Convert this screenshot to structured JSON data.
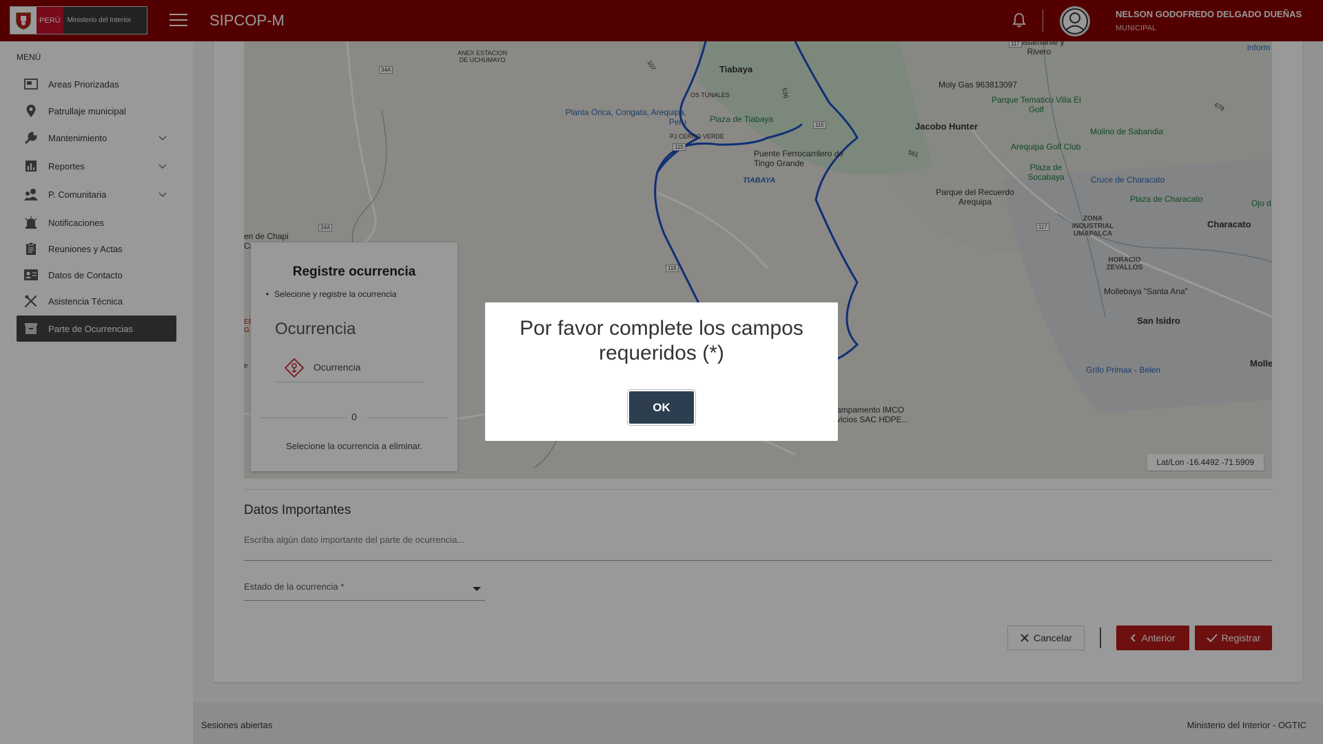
{
  "header": {
    "logo_country": "PERÚ",
    "logo_ministry": "Ministerio del Interior",
    "app_title": "SIPCOP-M",
    "user_name": "NELSON GODOFREDO DELGADO DUEÑAS",
    "user_role": "MUNICIPAL",
    "brand_color": "#8b0000"
  },
  "sidebar": {
    "menu_title": "MENÚ",
    "items": [
      {
        "label": "Areas Priorizadas",
        "icon": "map-area-icon",
        "expandable": false
      },
      {
        "label": "Patrullaje municipal",
        "icon": "location-pin-icon",
        "expandable": false
      },
      {
        "label": "Mantenimiento",
        "icon": "wrench-icon",
        "expandable": true
      },
      {
        "label": "Reportes",
        "icon": "bar-chart-icon",
        "expandable": true
      },
      {
        "label": "P. Comunitaria",
        "icon": "community-icon",
        "expandable": true
      },
      {
        "label": "Notificaciones",
        "icon": "alarm-icon",
        "expandable": false
      },
      {
        "label": "Reuniones y Actas",
        "icon": "clipboard-icon",
        "expandable": false
      },
      {
        "label": "Datos de Contacto",
        "icon": "contact-card-icon",
        "expandable": false
      },
      {
        "label": "Asistencia Técnica",
        "icon": "tools-icon",
        "expandable": false
      },
      {
        "label": "Parte de Ocurrencias",
        "icon": "archive-icon",
        "expandable": false,
        "active": true
      }
    ]
  },
  "map": {
    "latlon": "Lat/Lon -16.4492 -71.5909",
    "labels": {
      "tiabaya": "Tiabaya",
      "tiabaya_caps": "TIABAYA",
      "anexo": "ANEX ESTACION DE UCHUMAYO",
      "tunales": "OS TUNALES",
      "orica": "Planta Orica, Congata, Arequipa, Peru",
      "plaza_tiabaya": "Plaza de Tiabaya",
      "cerro_verde": "PJ CERRO VERDE",
      "puente": "Puente Ferrocarrilero de Tingo Grande",
      "moly": "Moly Gas 963813097",
      "bustamante": "Bustamante y Rivero",
      "inform": "inform",
      "parque_tematico": "Parque Tematico Villa El Golf",
      "jacobo": "Jacobo Hunter",
      "molino": "Molino de Sabandia",
      "golf": "Arequipa Golf Club",
      "socabaya": "Plaza de Socabaya",
      "cruce": "Cruce de Characato",
      "parque_recuerdo": "Parque del Recuerdo Arequipa",
      "plaza_characato": "Plaza de Characato",
      "ojo": "Ojo d",
      "zona": "ZONA INDUSTRIAL UMAPALCA",
      "characato": "Characato",
      "horacio": "HORACIO ZEVALLOS",
      "mollebaya": "Mollebaya \"Santa Ana\"",
      "san_isidro": "San Isidro",
      "grifo": "Grifo Primax - Belen",
      "molle": "Molle",
      "campamento": "ampamento IMCO vicios SAC HDPE...",
      "chapi": "en de Chapi",
      "cr": "Cr",
      "eb": "EB",
      "gg": "G",
      "ee": "e",
      "road_34a": "34A",
      "road_115": "115",
      "road_117": "117",
      "road_536": "536",
      "road_561": "561",
      "road_107": "107",
      "road_678": "678"
    }
  },
  "register_panel": {
    "title": "Registre ocurrencia",
    "bullet": "Selecione y registre la ocurrencia",
    "section": "Ocurrencia",
    "item_label": "Ocurrencia",
    "count": "0",
    "hint": "Selecione la ocurrencia a eliminar."
  },
  "form": {
    "datos_title": "Datos Importantes",
    "datos_placeholder": "Escriba algún dato importante del parte de ocurrencia...",
    "estado_label": "Estado de la ocurrencia *",
    "cancel": "Cancelar",
    "previous": "Anterior",
    "register": "Registrar"
  },
  "footer": {
    "left": "Sesiones abiertas",
    "right": "Ministerio del Interior - OGTIC"
  },
  "modal": {
    "message": "Por favor complete los campos requeridos (*)",
    "ok": "OK"
  }
}
